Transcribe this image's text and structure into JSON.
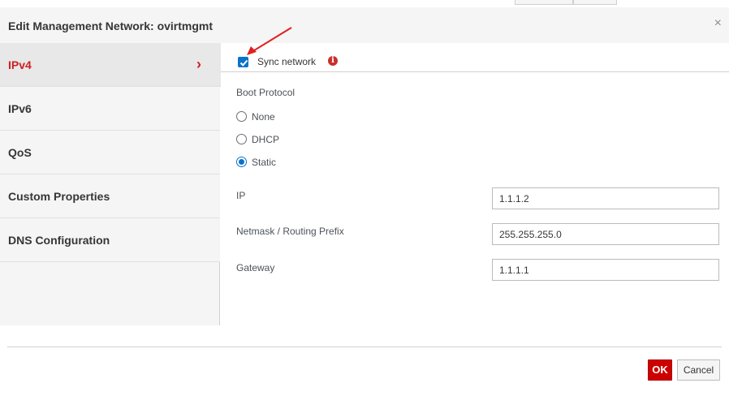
{
  "dialog": {
    "title": "Edit Management Network: ovirtmgmt",
    "close_symbol": "×"
  },
  "sidebar": {
    "items": [
      {
        "label": "IPv4",
        "active": true
      },
      {
        "label": "IPv6",
        "active": false
      },
      {
        "label": "QoS",
        "active": false
      },
      {
        "label": "Custom Properties",
        "active": false
      },
      {
        "label": "DNS Configuration",
        "active": false
      }
    ],
    "active_indicator": "›"
  },
  "sync": {
    "label": "Sync network",
    "checked": true,
    "info_symbol": "i"
  },
  "boot_protocol": {
    "label": "Boot Protocol",
    "options": [
      {
        "label": "None",
        "selected": false
      },
      {
        "label": "DHCP",
        "selected": false
      },
      {
        "label": "Static",
        "selected": true
      }
    ]
  },
  "fields": {
    "ip": {
      "label": "IP",
      "value": "1.1.1.2"
    },
    "netmask": {
      "label": "Netmask / Routing Prefix",
      "value": "255.255.255.0"
    },
    "gateway": {
      "label": "Gateway",
      "value": "1.1.1.1"
    }
  },
  "buttons": {
    "ok": "OK",
    "cancel": "Cancel"
  },
  "colors": {
    "accent_red": "#cc2222",
    "ok_button": "#cc0000",
    "checkbox_blue": "#0b72c9",
    "annotation_arrow": "#e02020"
  },
  "icons": {
    "close": "close-icon",
    "chevron": "chevron-right-icon",
    "info": "info-icon",
    "check": "check-icon"
  }
}
